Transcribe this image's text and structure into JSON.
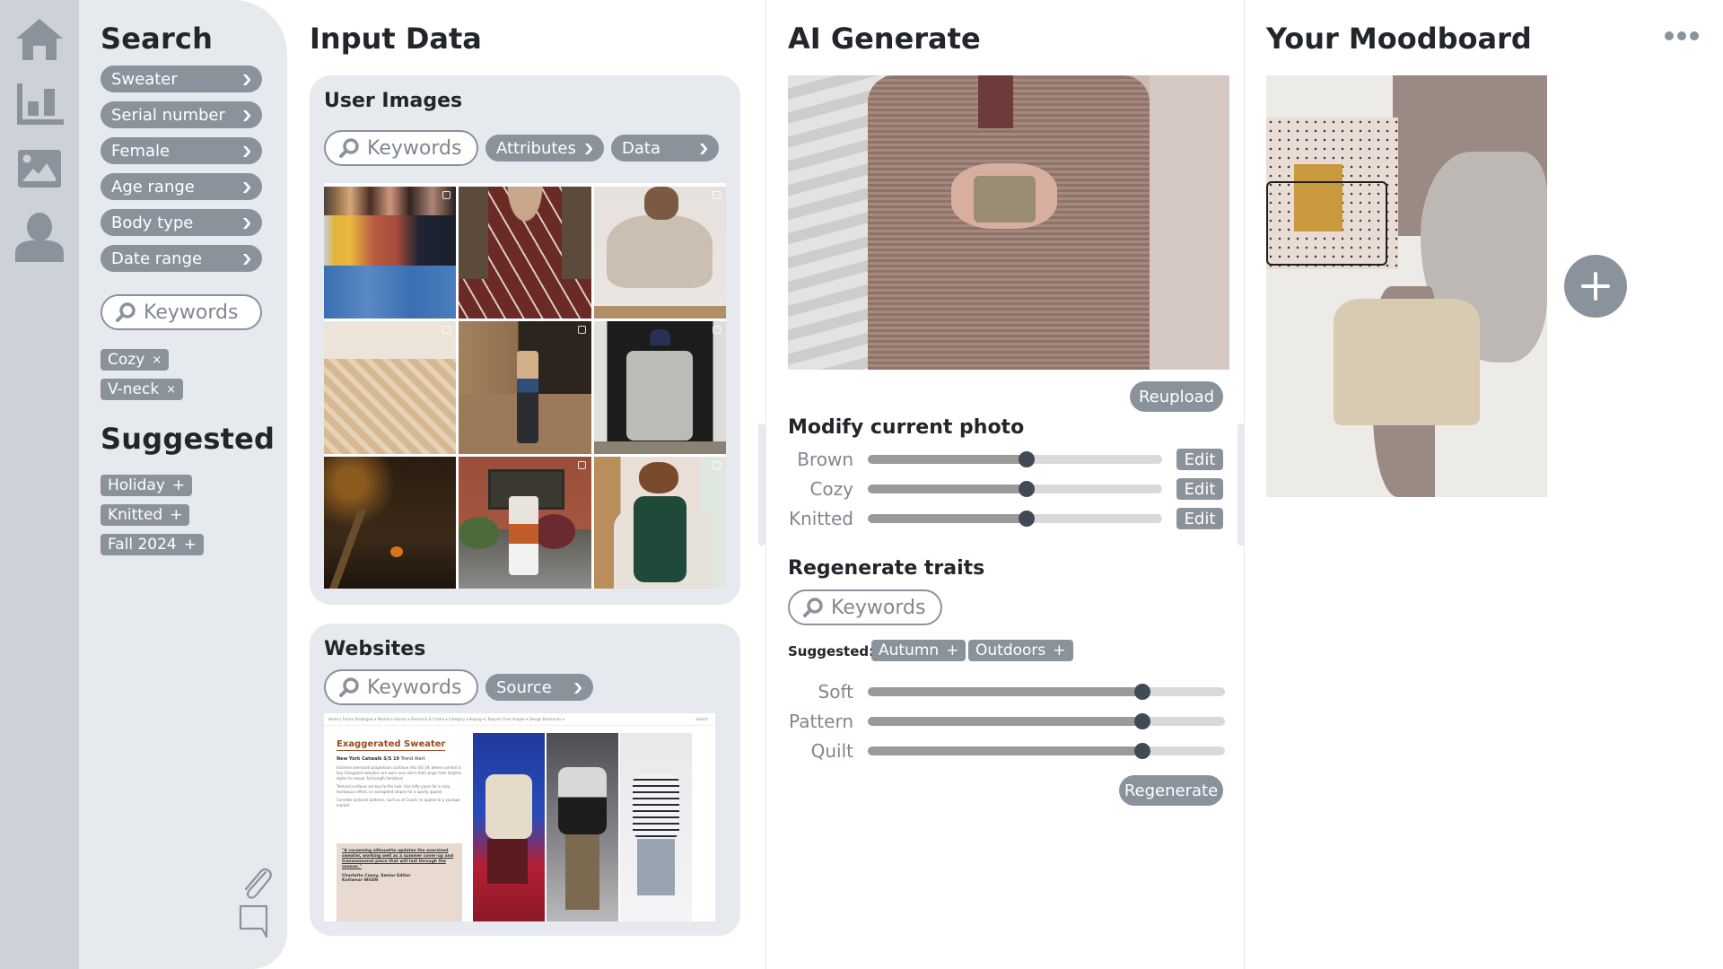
{
  "nav": {
    "items": [
      {
        "name": "home",
        "icon": "home-icon"
      },
      {
        "name": "analytics",
        "icon": "bar-chart-icon"
      },
      {
        "name": "images",
        "icon": "image-icon"
      },
      {
        "name": "profile",
        "icon": "user-icon"
      }
    ]
  },
  "search": {
    "title": "Search",
    "filters": [
      {
        "label": "Sweater"
      },
      {
        "label": "Serial number"
      },
      {
        "label": "Female"
      },
      {
        "label": "Age range"
      },
      {
        "label": "Body type"
      },
      {
        "label": "Date range"
      }
    ],
    "keywords_placeholder": "Keywords",
    "active_tags": [
      {
        "label": "Cozy",
        "action": "×"
      },
      {
        "label": "V-neck",
        "action": "×"
      }
    ],
    "suggested_title": "Suggested",
    "suggested_tags": [
      {
        "label": "Holiday",
        "action": "+"
      },
      {
        "label": "Knitted",
        "action": "+"
      },
      {
        "label": "Fall 2024",
        "action": "+"
      }
    ],
    "attach_icon": "paperclip-icon",
    "comment_icon": "comment-icon"
  },
  "input_data": {
    "title": "Input Data",
    "user_images": {
      "title": "User Images",
      "keywords_placeholder": "Keywords",
      "attributes_label": "Attributes",
      "data_label": "Data",
      "images": [
        {
          "desc": "Three women in sweaters and jeans"
        },
        {
          "desc": "Fair isle burgundy sweater"
        },
        {
          "desc": "Oversized oatmeal knit sweater"
        },
        {
          "desc": "Cream cable knit sweater"
        },
        {
          "desc": "Man in tan cardigan against wall"
        },
        {
          "desc": "Woman in grey long coat by door"
        },
        {
          "desc": "Porch with pumpkin at dusk"
        },
        {
          "desc": "Woman in patchwork cardigan and white boots"
        },
        {
          "desc": "Woman in green wrap dress reading"
        }
      ]
    },
    "websites": {
      "title": "Websites",
      "keywords_placeholder": "Keywords",
      "source_label": "Source",
      "preview": {
        "nav_text": "Home | Future Strategies ▾  Market ▾  Season ▾  Research & Create ▾  Category ▾  Buying ▾  | Reports  Fase  Images ▾  Design Resources ▾",
        "search_text": "Search",
        "headline": "Exaggerated Sweater",
        "subhead_bold": "New York Catwalk S/S 19",
        "subhead_rest": " Trend Alert",
        "bullets": [
          "Extreme oversized proportions continue into S/S 19, where comfort is key. Elongated sweaters are worn over skirts that range from ladylike styles to casual, full-length iterations",
          "Textural surfaces are key to the look. Use lofty yarns for a cozy, homespun effect, or variegated stripes for a sporty appeal",
          "Consider pictorial patterns, such as at Coach, to appeal to a younger market"
        ],
        "quote": "\"A cocooning silhouette updates the oversized sweater, working well as a summer cover-up and transseasonal piece that will last through the season.\"",
        "attribution_1": "Charlotte Casey, Senior Editor",
        "attribution_2": "Knitwear WGSN"
      }
    }
  },
  "ai_generate": {
    "title": "AI Generate",
    "reupload_label": "Reupload",
    "modify": {
      "title": "Modify current photo",
      "sliders": [
        {
          "label": "Brown",
          "value": 0.54,
          "edit_label": "Edit"
        },
        {
          "label": "Cozy",
          "value": 0.54,
          "edit_label": "Edit"
        },
        {
          "label": "Knitted",
          "value": 0.54,
          "edit_label": "Edit"
        }
      ]
    },
    "regenerate": {
      "title": "Regenerate traits",
      "keywords_placeholder": "Keywords",
      "suggested_label": "Suggested:",
      "suggested_tags": [
        {
          "label": "Autumn",
          "action": "+"
        },
        {
          "label": "Outdoors",
          "action": "+"
        }
      ],
      "sliders": [
        {
          "label": "Soft",
          "value": 0.77
        },
        {
          "label": "Pattern",
          "value": 0.77
        },
        {
          "label": "Quilt",
          "value": 0.77
        }
      ],
      "button_label": "Regenerate"
    }
  },
  "moodboard": {
    "title": "Your Moodboard",
    "more_icon": "more-horizontal-icon",
    "add_icon": "plus-icon",
    "items": [
      {
        "desc": "Beige knit sweater on hanger by pegboard shelf"
      }
    ]
  },
  "colors": {
    "rail_bg": "#cdd2da",
    "panel_bg": "#e6e9ed",
    "pill_bg": "#8a939c",
    "slider_thumb": "#414a54",
    "text_dark": "#22262b"
  }
}
